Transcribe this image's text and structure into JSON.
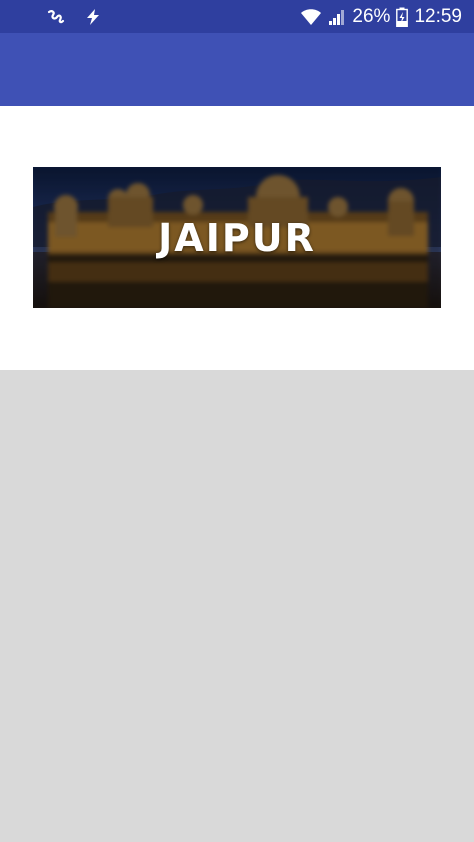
{
  "status_bar": {
    "battery_percent": "26%",
    "time": "12:59",
    "icons": [
      "notification-squiggle-icon",
      "flash-icon",
      "wifi-icon",
      "signal-icon",
      "battery-charging-icon"
    ]
  },
  "banner": {
    "title": "JAIPUR"
  },
  "colors": {
    "status_bar": "#2f3f9f",
    "app_bar": "#3f51b5",
    "background": "#ffffff",
    "empty_area": "#d9d9d9"
  }
}
